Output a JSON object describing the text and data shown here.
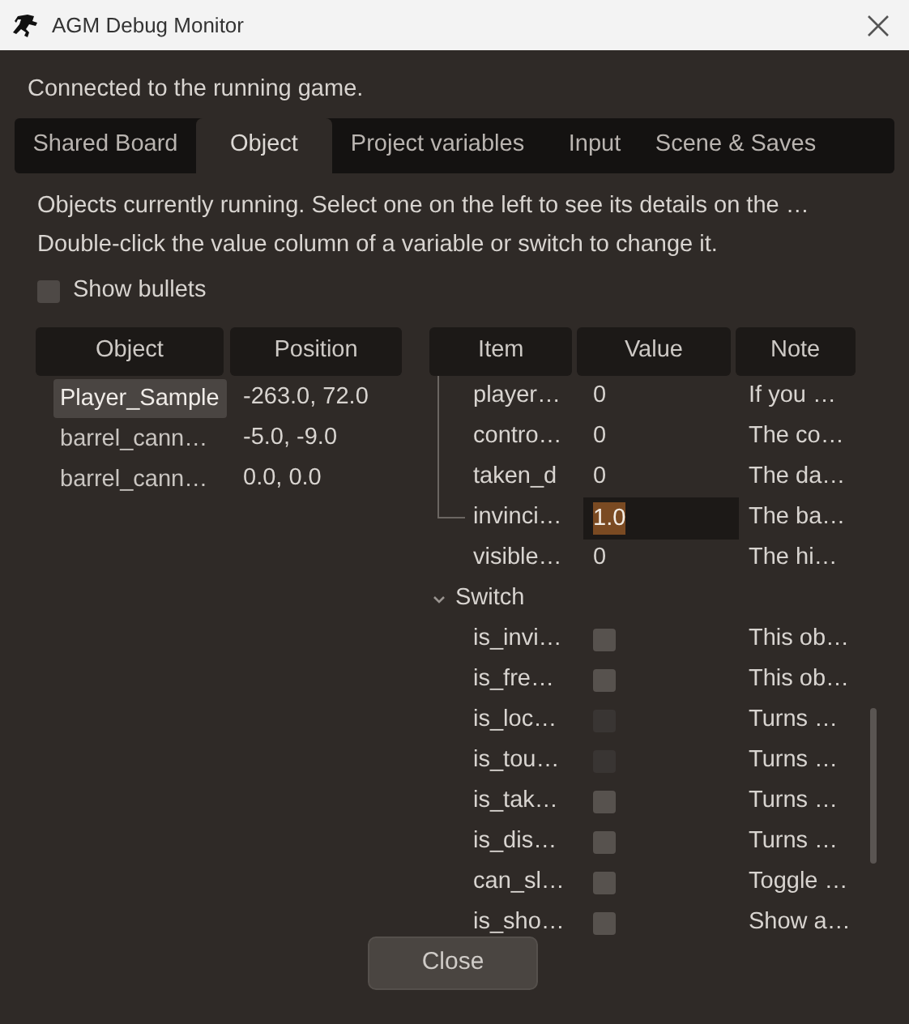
{
  "window": {
    "title": "AGM Debug Monitor"
  },
  "status": "Connected to the running game.",
  "tabs": [
    {
      "label": "Shared Board",
      "selected": false
    },
    {
      "label": "Object",
      "selected": true
    },
    {
      "label": "Project variables",
      "selected": false
    },
    {
      "label": "Input",
      "selected": false
    },
    {
      "label": "Scene & Saves",
      "selected": false
    }
  ],
  "description": [
    "Objects currently running. Select one on the left to see its details on the …",
    "Double-click the value column of a variable or switch to change it."
  ],
  "show_bullets": {
    "label": "Show bullets",
    "checked": false
  },
  "objects_table": {
    "columns": [
      "Object",
      "Position"
    ],
    "rows": [
      {
        "object": "Player_Sample",
        "position": "-263.0, 72.0",
        "selected": true
      },
      {
        "object": "barrel_cann…",
        "position": "-5.0, -9.0",
        "selected": false
      },
      {
        "object": "barrel_cann…",
        "position": "0.0, 0.0",
        "selected": false
      }
    ]
  },
  "details_table": {
    "columns": [
      "Item",
      "Value",
      "Note"
    ],
    "variables": [
      {
        "item": "player…",
        "value": "0",
        "note": "If you …",
        "editing": false
      },
      {
        "item": "contro…",
        "value": "0",
        "note": "The co…",
        "editing": false
      },
      {
        "item": "taken_d",
        "value": "0",
        "note": "The da…",
        "editing": false
      },
      {
        "item": "invinci…",
        "value": "1.0",
        "note": "The ba…",
        "editing": true
      },
      {
        "item": "visible…",
        "value": "0",
        "note": "The hi…",
        "editing": false
      }
    ],
    "groups": [
      {
        "label": "Switch",
        "expanded": true,
        "children": [
          {
            "item": "is_invi…",
            "checked": false,
            "disabled": false,
            "note": "This ob…"
          },
          {
            "item": "is_fre…",
            "checked": false,
            "disabled": false,
            "note": "This ob…"
          },
          {
            "item": "is_loc…",
            "checked": false,
            "disabled": true,
            "note": "Turns …"
          },
          {
            "item": "is_tou…",
            "checked": false,
            "disabled": true,
            "note": "Turns …"
          },
          {
            "item": "is_tak…",
            "checked": false,
            "disabled": false,
            "note": "Turns …"
          },
          {
            "item": "is_dis…",
            "checked": false,
            "disabled": false,
            "note": "Turns …"
          },
          {
            "item": "can_sl…",
            "checked": false,
            "disabled": false,
            "note": "Toggle …"
          },
          {
            "item": "is_sho…",
            "checked": false,
            "disabled": false,
            "note": "Show a…"
          }
        ]
      }
    ]
  },
  "buttons": [
    "Close"
  ]
}
